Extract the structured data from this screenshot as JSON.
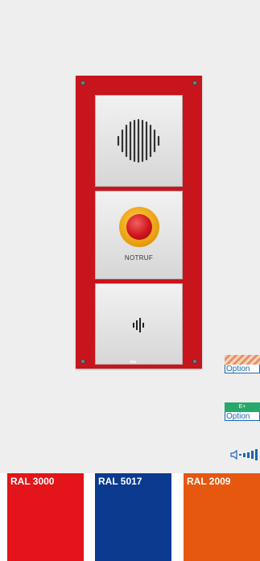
{
  "device": {
    "panel_color": "#c8141c",
    "button_label": "NOTRUF",
    "logo_text": "tas"
  },
  "options": [
    {
      "label": "Option",
      "icon": "shield-badge-icon"
    },
    {
      "label": "Option",
      "badge": "E+",
      "badge_color": "#28a86a"
    }
  ],
  "speaker_icon": "speaker-volume-icon",
  "swatches": [
    {
      "label": "RAL 3000",
      "color": "#e3141a"
    },
    {
      "label": "RAL 5017",
      "color": "#0b3a8f"
    },
    {
      "label": "RAL 2009",
      "color": "#e65710"
    }
  ]
}
